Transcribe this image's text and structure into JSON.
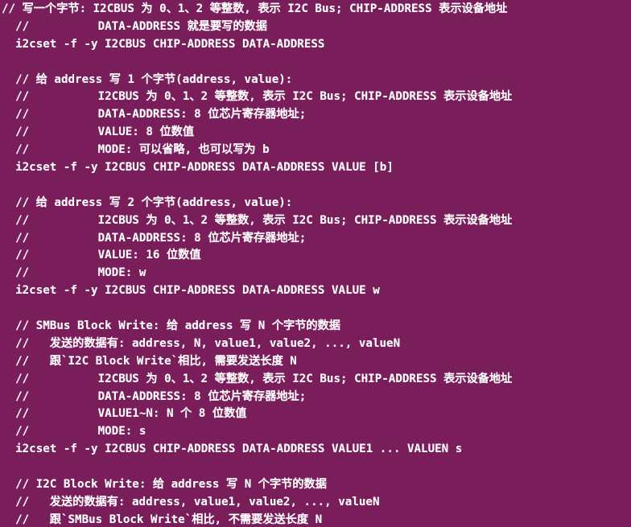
{
  "window": {
    "background": "#7a1d5b",
    "foreground": "#ffffff"
  },
  "terminal": {
    "lines": [
      "// 写一个字节: I2CBUS 为 0、1、2 等整数, 表示 I2C Bus; CHIP-ADDRESS 表示设备地址",
      "  //          DATA-ADDRESS 就是要写的数据",
      "  i2cset -f -y I2CBUS CHIP-ADDRESS DATA-ADDRESS",
      "",
      "  // 给 address 写 1 个字节(address, value):",
      "  //          I2CBUS 为 0、1、2 等整数, 表示 I2C Bus; CHIP-ADDRESS 表示设备地址",
      "  //          DATA-ADDRESS: 8 位芯片寄存器地址;",
      "  //          VALUE: 8 位数值",
      "  //          MODE: 可以省略, 也可以写为 b",
      "  i2cset -f -y I2CBUS CHIP-ADDRESS DATA-ADDRESS VALUE [b]",
      "",
      "  // 给 address 写 2 个字节(address, value):",
      "  //          I2CBUS 为 0、1、2 等整数, 表示 I2C Bus; CHIP-ADDRESS 表示设备地址",
      "  //          DATA-ADDRESS: 8 位芯片寄存器地址;",
      "  //          VALUE: 16 位数值",
      "  //          MODE: w",
      "  i2cset -f -y I2CBUS CHIP-ADDRESS DATA-ADDRESS VALUE w",
      "",
      "  // SMBus Block Write: 给 address 写 N 个字节的数据",
      "  //   发送的数据有: address, N, value1, value2, ..., valueN",
      "  //   跟`I2C Block Write`相比, 需要发送长度 N",
      "  //          I2CBUS 为 0、1、2 等整数, 表示 I2C Bus; CHIP-ADDRESS 表示设备地址",
      "  //          DATA-ADDRESS: 8 位芯片寄存器地址;",
      "  //          VALUE1~N: N 个 8 位数值",
      "  //          MODE: s",
      "  i2cset -f -y I2CBUS CHIP-ADDRESS DATA-ADDRESS VALUE1 ... VALUEN s",
      "",
      "  // I2C Block Write: 给 address 写 N 个字节的数据",
      "  //   发送的数据有: address, value1, value2, ..., valueN",
      "  //   跟`SMBus Block Write`相比, 不需要发送长度 N"
    ]
  }
}
